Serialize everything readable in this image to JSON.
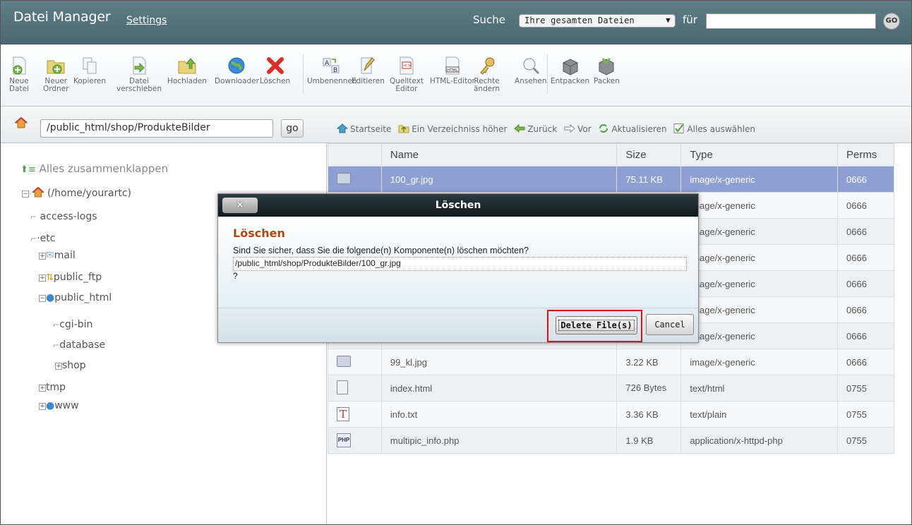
{
  "header": {
    "title": "Datei Manager",
    "settings": "Settings",
    "search_label": "Suche",
    "search_scope": "Ihre gesamten Dateien",
    "for_label": "für",
    "go": "GO"
  },
  "toolbar": [
    {
      "l1": "Neue",
      "l2": "Datei",
      "icon": "new-file-icon"
    },
    {
      "l1": "Neuer",
      "l2": "Ordner",
      "icon": "new-folder-icon"
    },
    {
      "l1": "Kopieren",
      "l2": "",
      "icon": "copy-icon"
    },
    {
      "l1": "Datei",
      "l2": "verschieben",
      "icon": "move-icon"
    },
    {
      "l1": "Hochladen",
      "l2": "",
      "icon": "upload-icon"
    },
    {
      "l1": "Downloader",
      "l2": "",
      "icon": "download-icon"
    },
    {
      "l1": "Löschen",
      "l2": "",
      "icon": "delete-icon"
    },
    {
      "l1": "Umbenennen",
      "l2": "",
      "icon": "rename-icon"
    },
    {
      "l1": "Editieren",
      "l2": "",
      "icon": "edit-icon"
    },
    {
      "l1": "Quelltext",
      "l2": "Editor",
      "icon": "code-editor-icon"
    },
    {
      "l1": "HTML-Editor",
      "l2": "",
      "icon": "html-editor-icon"
    },
    {
      "l1": "Rechte",
      "l2": "ändern",
      "icon": "permissions-icon"
    },
    {
      "l1": "Ansehen",
      "l2": "",
      "icon": "view-icon"
    },
    {
      "l1": "Entpacken",
      "l2": "",
      "icon": "extract-icon"
    },
    {
      "l1": "Packen",
      "l2": "",
      "icon": "compress-icon"
    }
  ],
  "pathbar": {
    "path": "/public_html/shop/ProdukteBilder",
    "go": "go",
    "nav": [
      "Startseite",
      "Ein Verzeichniss höher",
      "Zurück",
      "Vor",
      "Aktualisieren",
      "Alles auswählen"
    ]
  },
  "tree": {
    "collapse_all": "Alles zusammenklappen",
    "root": "(/home/yourartc)",
    "items": [
      "access-logs",
      "etc",
      "mail",
      "public_ftp",
      "public_html",
      "cgi-bin",
      "database",
      "shop",
      "tmp",
      "www"
    ]
  },
  "table": {
    "headers": [
      "Name",
      "Size",
      "Type",
      "Perms"
    ],
    "rows": [
      {
        "name": "100_gr.jpg",
        "size": "75.11 KB",
        "type": "image/x-generic",
        "perms": "0666"
      },
      {
        "name": "",
        "size": "",
        "type": "image/x-generic",
        "perms": "0666"
      },
      {
        "name": "",
        "size": "",
        "type": "image/x-generic",
        "perms": "0666"
      },
      {
        "name": "",
        "size": "",
        "type": "image/x-generic",
        "perms": "0666"
      },
      {
        "name": "",
        "size": "",
        "type": "image/x-generic",
        "perms": "0666"
      },
      {
        "name": "",
        "size": "",
        "type": "image/x-generic",
        "perms": "0666"
      },
      {
        "name": "",
        "size": "",
        "type": "image/x-generic",
        "perms": "0666"
      },
      {
        "name": "99_kl.jpg",
        "size": "3.22 KB",
        "type": "image/x-generic",
        "perms": "0666"
      },
      {
        "name": "index.html",
        "size": "726 Bytes",
        "type": "text/html",
        "perms": "0755"
      },
      {
        "name": "info.txt",
        "size": "3.36 KB",
        "type": "text/plain",
        "perms": "0755"
      },
      {
        "name": "multipic_info.php",
        "size": "1.9 KB",
        "type": "application/x-httpd-php",
        "perms": "0755"
      }
    ]
  },
  "modal": {
    "title": "Löschen",
    "close": "×",
    "heading": "Löschen",
    "question": "Sind Sie sicher, dass Sie die folgende(n) Komponente(n) löschen möchten?",
    "filepath": "/public_html/shop/ProdukteBilder/100_gr.jpg",
    "qmark": "?",
    "delete": "Delete File(s)",
    "cancel": "Cancel"
  }
}
